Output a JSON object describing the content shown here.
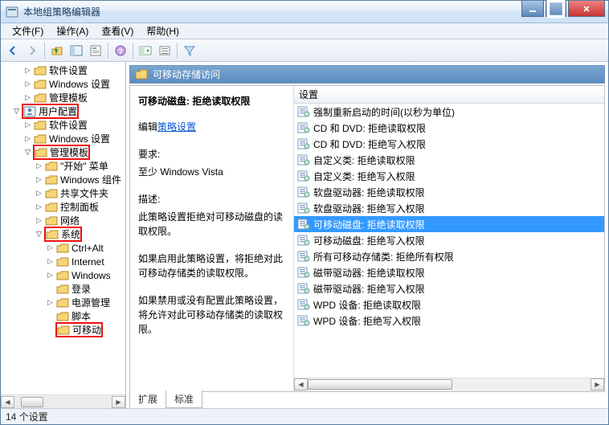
{
  "title": "本地组策略编辑器",
  "menu": {
    "file": "文件(F)",
    "action": "操作(A)",
    "view": "查看(V)",
    "help": "帮助(H)"
  },
  "tree": {
    "items": [
      {
        "indent": 2,
        "exp": "closed",
        "label": "软件设置"
      },
      {
        "indent": 2,
        "exp": "closed",
        "label": "Windows 设置"
      },
      {
        "indent": 2,
        "exp": "closed",
        "label": "管理模板"
      },
      {
        "indent": 1,
        "exp": "open",
        "label": "用户配置",
        "user": true,
        "red": true
      },
      {
        "indent": 2,
        "exp": "closed",
        "label": "软件设置"
      },
      {
        "indent": 2,
        "exp": "closed",
        "label": "Windows 设置"
      },
      {
        "indent": 2,
        "exp": "open",
        "label": "管理模板",
        "red": true
      },
      {
        "indent": 3,
        "exp": "closed",
        "label": "\"开始\" 菜单"
      },
      {
        "indent": 3,
        "exp": "closed",
        "label": "Windows 组件"
      },
      {
        "indent": 3,
        "exp": "closed",
        "label": "共享文件夹"
      },
      {
        "indent": 3,
        "exp": "closed",
        "label": "控制面板"
      },
      {
        "indent": 3,
        "exp": "closed",
        "label": "网络"
      },
      {
        "indent": 3,
        "exp": "open",
        "label": "系统",
        "red": true
      },
      {
        "indent": 4,
        "exp": "closed",
        "label": "Ctrl+Alt"
      },
      {
        "indent": 4,
        "exp": "closed",
        "label": "Internet"
      },
      {
        "indent": 4,
        "exp": "closed",
        "label": "Windows"
      },
      {
        "indent": 4,
        "exp": "none",
        "label": "登录"
      },
      {
        "indent": 4,
        "exp": "closed",
        "label": "电源管理"
      },
      {
        "indent": 4,
        "exp": "none",
        "label": "脚本"
      },
      {
        "indent": 4,
        "exp": "none",
        "label": "可移动",
        "red": true
      }
    ]
  },
  "panel": {
    "header": "可移动存储访问",
    "desc": {
      "title": "可移动磁盘: 拒绝读取权限",
      "edit_prefix": "编辑",
      "edit_link": "策略设置",
      "req_label": "要求:",
      "req_value": "至少 Windows Vista",
      "desc_label": "描述:",
      "desc_body": "此策略设置拒绝对可移动磁盘的读取权限。",
      "enable_body": "如果启用此策略设置，将拒绝对此可移动存储类的读取权限。",
      "disable_body": "如果禁用或没有配置此策略设置，将允许对此可移动存储类的读取权限。"
    },
    "list": {
      "col": "设置",
      "rows": [
        {
          "label": "强制重新启动的时间(以秒为单位)"
        },
        {
          "label": "CD 和 DVD: 拒绝读取权限"
        },
        {
          "label": "CD 和 DVD: 拒绝写入权限"
        },
        {
          "label": "自定义类: 拒绝读取权限"
        },
        {
          "label": "自定义类: 拒绝写入权限"
        },
        {
          "label": "软盘驱动器: 拒绝读取权限"
        },
        {
          "label": "软盘驱动器: 拒绝写入权限"
        },
        {
          "label": "可移动磁盘: 拒绝读取权限",
          "selected": true
        },
        {
          "label": "可移动磁盘: 拒绝写入权限"
        },
        {
          "label": "所有可移动存储类: 拒绝所有权限"
        },
        {
          "label": "磁带驱动器: 拒绝读取权限"
        },
        {
          "label": "磁带驱动器: 拒绝写入权限"
        },
        {
          "label": "WPD 设备: 拒绝读取权限"
        },
        {
          "label": "WPD 设备: 拒绝写入权限"
        }
      ]
    }
  },
  "tabs": {
    "extended": "扩展",
    "standard": "标准"
  },
  "status": "14 个设置"
}
